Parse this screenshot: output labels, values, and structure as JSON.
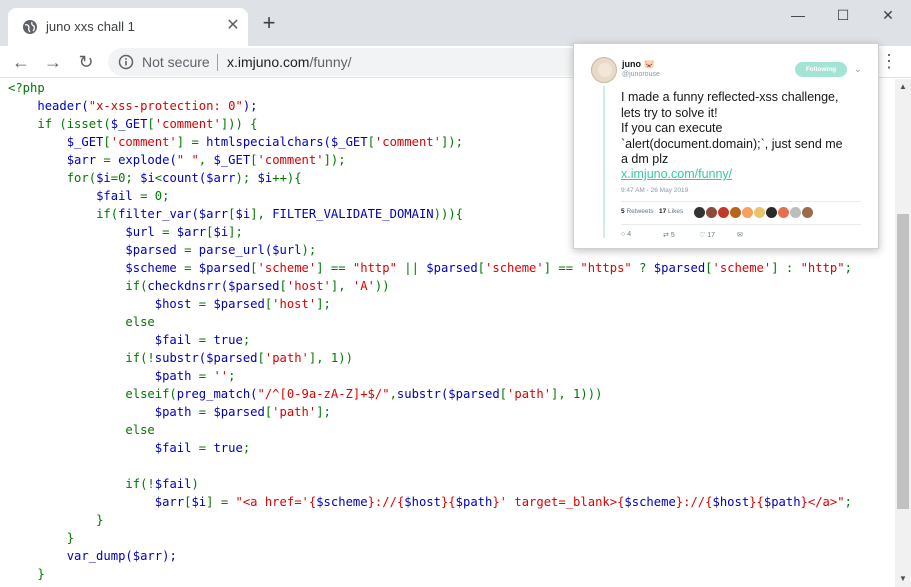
{
  "browser": {
    "tab_title": "juno xxs chall 1",
    "new_tab_label": "+",
    "security_label": "Not secure",
    "url_host": "x.imjuno.com",
    "url_path": "/funny/",
    "minimize_glyph": "—",
    "maximize_glyph": "☐",
    "close_glyph": "✕"
  },
  "code_lines": [
    [
      [
        "k",
        "<?php"
      ]
    ],
    [
      [
        "t",
        "    "
      ],
      [
        "d",
        "header("
      ],
      [
        "s",
        "\"x-xss-protection: 0\""
      ],
      [
        "d",
        ");"
      ]
    ],
    [
      [
        "t",
        "    "
      ],
      [
        "k",
        "if (isset("
      ],
      [
        "v",
        "$_GET"
      ],
      [
        "k",
        "["
      ],
      [
        "s",
        "'comment'"
      ],
      [
        "k",
        "])) {"
      ]
    ],
    [
      [
        "t",
        "        "
      ],
      [
        "v",
        "$_GET"
      ],
      [
        "k",
        "["
      ],
      [
        "s",
        "'comment'"
      ],
      [
        "k",
        "] = "
      ],
      [
        "d",
        "htmlspecialchars("
      ],
      [
        "v",
        "$_GET"
      ],
      [
        "k",
        "["
      ],
      [
        "s",
        "'comment'"
      ],
      [
        "k",
        "]);"
      ]
    ],
    [
      [
        "t",
        "        "
      ],
      [
        "v",
        "$arr"
      ],
      [
        "k",
        " = "
      ],
      [
        "d",
        "explode("
      ],
      [
        "s",
        "\" \""
      ],
      [
        "k",
        ", "
      ],
      [
        "v",
        "$_GET"
      ],
      [
        "k",
        "["
      ],
      [
        "s",
        "'comment'"
      ],
      [
        "k",
        "]);"
      ]
    ],
    [
      [
        "t",
        "        "
      ],
      [
        "k",
        "for("
      ],
      [
        "v",
        "$i"
      ],
      [
        "k",
        "=0; "
      ],
      [
        "v",
        "$i"
      ],
      [
        "k",
        "<"
      ],
      [
        "d",
        "count("
      ],
      [
        "v",
        "$arr"
      ],
      [
        "k",
        "); "
      ],
      [
        "v",
        "$i"
      ],
      [
        "k",
        "++){"
      ]
    ],
    [
      [
        "t",
        "            "
      ],
      [
        "v",
        "$fail"
      ],
      [
        "k",
        " = 0;"
      ]
    ],
    [
      [
        "t",
        "            "
      ],
      [
        "k",
        "if("
      ],
      [
        "d",
        "filter_var("
      ],
      [
        "v",
        "$arr"
      ],
      [
        "k",
        "["
      ],
      [
        "v",
        "$i"
      ],
      [
        "k",
        "], "
      ],
      [
        "d",
        "FILTER_VALIDATE_DOMAIN"
      ],
      [
        "k",
        "))){"
      ]
    ],
    [
      [
        "t",
        "                "
      ],
      [
        "v",
        "$url"
      ],
      [
        "k",
        " = "
      ],
      [
        "v",
        "$arr"
      ],
      [
        "k",
        "["
      ],
      [
        "v",
        "$i"
      ],
      [
        "k",
        "];"
      ]
    ],
    [
      [
        "t",
        "                "
      ],
      [
        "v",
        "$parsed"
      ],
      [
        "k",
        " = "
      ],
      [
        "d",
        "parse_url("
      ],
      [
        "v",
        "$url"
      ],
      [
        "k",
        ");"
      ]
    ],
    [
      [
        "t",
        "                "
      ],
      [
        "v",
        "$scheme"
      ],
      [
        "k",
        " = "
      ],
      [
        "v",
        "$parsed"
      ],
      [
        "k",
        "["
      ],
      [
        "s",
        "'scheme'"
      ],
      [
        "k",
        "] == "
      ],
      [
        "s",
        "\"http\""
      ],
      [
        "k",
        " || "
      ],
      [
        "v",
        "$parsed"
      ],
      [
        "k",
        "["
      ],
      [
        "s",
        "'scheme'"
      ],
      [
        "k",
        "] == "
      ],
      [
        "s",
        "\"https\""
      ],
      [
        "k",
        " ? "
      ],
      [
        "v",
        "$parsed"
      ],
      [
        "k",
        "["
      ],
      [
        "s",
        "'scheme'"
      ],
      [
        "k",
        "] : "
      ],
      [
        "s",
        "\"http\""
      ],
      [
        "k",
        ";"
      ]
    ],
    [
      [
        "t",
        "                "
      ],
      [
        "k",
        "if("
      ],
      [
        "d",
        "checkdnsrr("
      ],
      [
        "v",
        "$parsed"
      ],
      [
        "k",
        "["
      ],
      [
        "s",
        "'host'"
      ],
      [
        "k",
        "], "
      ],
      [
        "s",
        "'A'"
      ],
      [
        "k",
        "))"
      ]
    ],
    [
      [
        "t",
        "                    "
      ],
      [
        "v",
        "$host"
      ],
      [
        "k",
        " = "
      ],
      [
        "v",
        "$parsed"
      ],
      [
        "k",
        "["
      ],
      [
        "s",
        "'host'"
      ],
      [
        "k",
        "];"
      ]
    ],
    [
      [
        "t",
        "                "
      ],
      [
        "k",
        "else"
      ]
    ],
    [
      [
        "t",
        "                    "
      ],
      [
        "v",
        "$fail"
      ],
      [
        "k",
        " = "
      ],
      [
        "d",
        "true"
      ],
      [
        "k",
        ";"
      ]
    ],
    [
      [
        "t",
        "                "
      ],
      [
        "k",
        "if(!"
      ],
      [
        "d",
        "substr("
      ],
      [
        "v",
        "$parsed"
      ],
      [
        "k",
        "["
      ],
      [
        "s",
        "'path'"
      ],
      [
        "k",
        "], 1))"
      ]
    ],
    [
      [
        "t",
        "                    "
      ],
      [
        "v",
        "$path"
      ],
      [
        "k",
        " = "
      ],
      [
        "s",
        "''"
      ],
      [
        "k",
        ";"
      ]
    ],
    [
      [
        "t",
        "                "
      ],
      [
        "k",
        "elseif("
      ],
      [
        "d",
        "preg_match("
      ],
      [
        "s",
        "\"/^[0-9a-zA-Z]+$/\""
      ],
      [
        "k",
        ","
      ],
      [
        "d",
        "substr("
      ],
      [
        "v",
        "$parsed"
      ],
      [
        "k",
        "["
      ],
      [
        "s",
        "'path'"
      ],
      [
        "k",
        "], 1)))"
      ]
    ],
    [
      [
        "t",
        "                    "
      ],
      [
        "v",
        "$path"
      ],
      [
        "k",
        " = "
      ],
      [
        "v",
        "$parsed"
      ],
      [
        "k",
        "["
      ],
      [
        "s",
        "'path'"
      ],
      [
        "k",
        "];"
      ]
    ],
    [
      [
        "t",
        "                "
      ],
      [
        "k",
        "else"
      ]
    ],
    [
      [
        "t",
        "                    "
      ],
      [
        "v",
        "$fail"
      ],
      [
        "k",
        " = "
      ],
      [
        "d",
        "true"
      ],
      [
        "k",
        ";"
      ]
    ],
    [
      [
        "t",
        ""
      ]
    ],
    [
      [
        "t",
        "                "
      ],
      [
        "k",
        "if(!"
      ],
      [
        "v",
        "$fail"
      ],
      [
        "k",
        ")"
      ]
    ],
    [
      [
        "t",
        "                    "
      ],
      [
        "v",
        "$arr"
      ],
      [
        "k",
        "["
      ],
      [
        "v",
        "$i"
      ],
      [
        "k",
        "] = "
      ],
      [
        "s",
        "\"<a href='{"
      ],
      [
        "v",
        "$scheme"
      ],
      [
        "s",
        "}://{"
      ],
      [
        "v",
        "$host"
      ],
      [
        "s",
        "}{"
      ],
      [
        "v",
        "$path"
      ],
      [
        "s",
        "}' target=_blank>{"
      ],
      [
        "v",
        "$scheme"
      ],
      [
        "s",
        "}://{"
      ],
      [
        "v",
        "$host"
      ],
      [
        "s",
        "}{"
      ],
      [
        "v",
        "$path"
      ],
      [
        "s",
        "}</a>\""
      ],
      [
        "k",
        ";"
      ]
    ],
    [
      [
        "t",
        "            "
      ],
      [
        "k",
        "}"
      ]
    ],
    [
      [
        "t",
        "        "
      ],
      [
        "k",
        "}"
      ]
    ],
    [
      [
        "t",
        "        "
      ],
      [
        "d",
        "var_dump("
      ],
      [
        "v",
        "$arr"
      ],
      [
        "d",
        ");"
      ]
    ],
    [
      [
        "t",
        "    "
      ],
      [
        "k",
        "}"
      ]
    ]
  ],
  "tweet": {
    "name": "juno",
    "handle": "@junorouse",
    "follow_label": "Following",
    "text_lines": [
      "I made a funny reflected-xss challenge,",
      "lets try to solve it!",
      "If you can execute",
      "`alert(document.domain);`, just send me",
      "a dm plz"
    ],
    "link": "x.imjuno.com/funny/",
    "timestamp": "9:47 AM - 26 May 2019",
    "retweets_count": "5",
    "retweets_label": "Retweets",
    "likes_count": "17",
    "likes_label": "Likes",
    "replies": "4",
    "retweets_action": "5",
    "likes_action": "17",
    "liker_colors": [
      "#333333",
      "#8a4b3a",
      "#c0392b",
      "#b5651d",
      "#f4a261",
      "#e9c46a",
      "#2a2a2a",
      "#e76f51",
      "#bdbdbd",
      "#9c6b4e"
    ]
  },
  "colors": {
    "keyword": "#007700",
    "string": "#dd0000",
    "variable": "#0000bb",
    "link": "#36c9a6"
  }
}
